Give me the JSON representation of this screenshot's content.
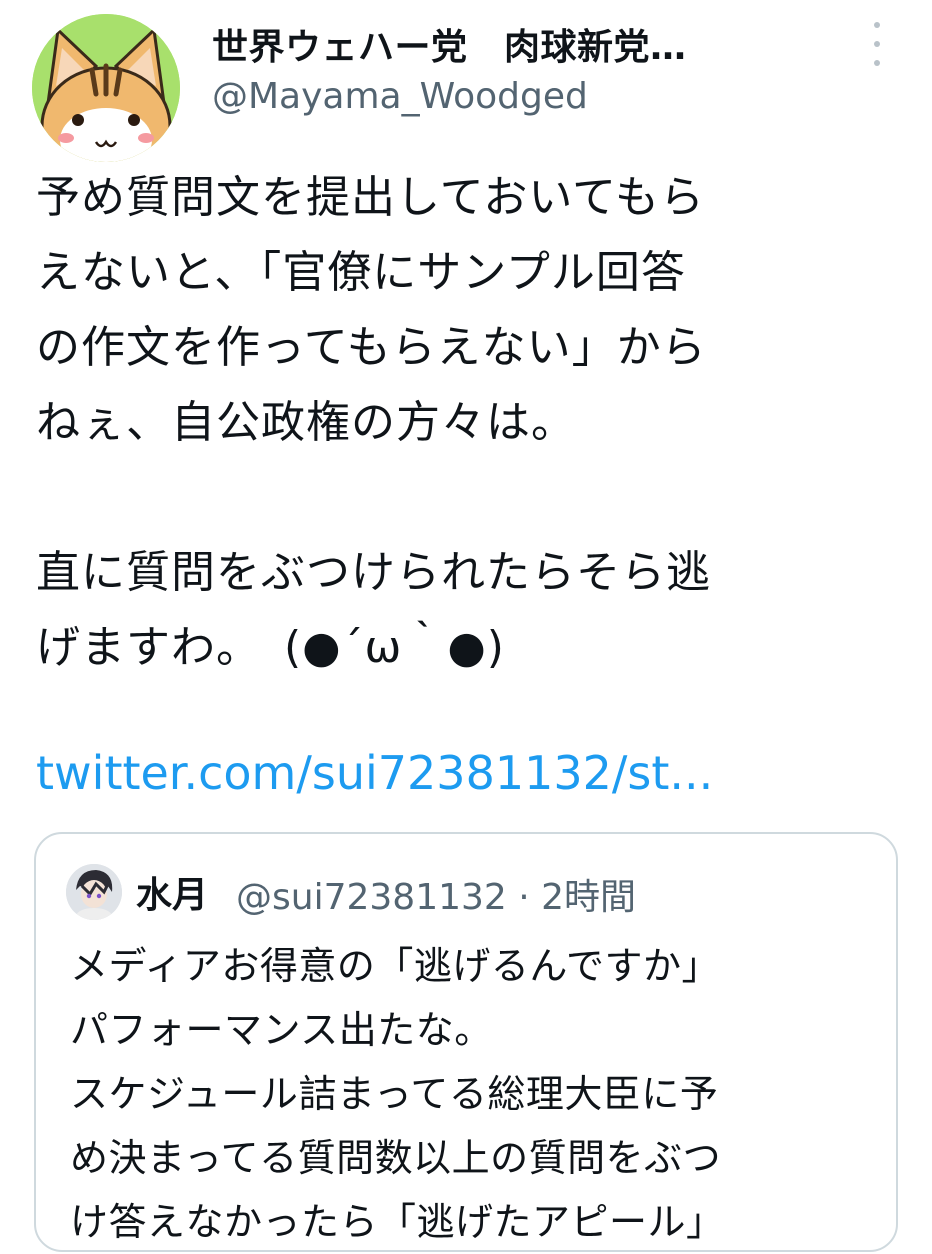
{
  "author": {
    "display_name": "世界ウェハー党　肉球新党…",
    "handle": "@Mayama_Woodged",
    "avatar_icon": "cat-avatar-icon"
  },
  "tweet": {
    "text": "予め質問文を提出しておいてもら\nえないと、「官僚にサンプル回答\nの作文を作ってもらえない」から\nねぇ、自公政権の方々は。\n\n直に質問をぶつけられたらそら逃\nげますわ。　(●´ω｀●)",
    "link": "twitter.com/sui72381132/st..."
  },
  "quote": {
    "name": "水月",
    "meta": "@sui72381132 · 2時間",
    "text": "メディアお得意の「逃げるんですか」\nパフォーマンス出たな。\nスケジュール詰まってる総理大臣に予\nめ決まってる質問数以上の質問をぶつ\nけ答えなかったら「逃げたアピール」"
  },
  "colors": {
    "link": "#1d9bf0",
    "secondary_text": "#536471",
    "border": "#cfd9de",
    "avatar_bg": "#a8e06c"
  }
}
